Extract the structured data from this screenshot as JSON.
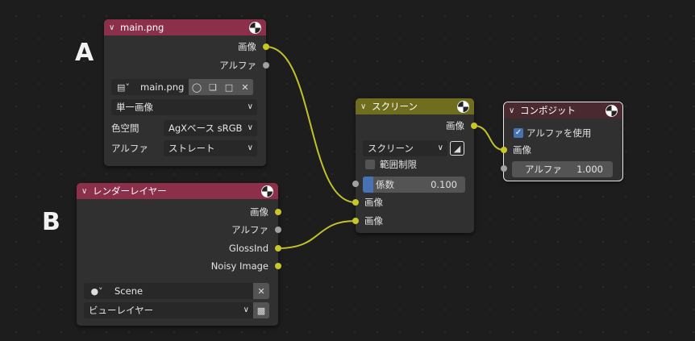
{
  "annotations": {
    "a": "A",
    "b": "B"
  },
  "image_node": {
    "title": "main.png",
    "out_image": "画像",
    "out_alpha": "アルファ",
    "image_name": "main.png",
    "source": "単一画像",
    "color_space_label": "色空間",
    "color_space_value": "AgXベース sRGB",
    "alpha_label": "アルファ",
    "alpha_value": "ストレート",
    "header_color": "#8c2f4a"
  },
  "render_node": {
    "title": "レンダーレイヤー",
    "out_image": "画像",
    "out_alpha": "アルファ",
    "out_glossind": "GlossInd",
    "out_noisy": "Noisy Image",
    "scene": "Scene",
    "view_layer": "ビューレイヤー",
    "header_color": "#8c2f4a"
  },
  "screen_node": {
    "title": "スクリーン",
    "out_image": "画像",
    "blend_mode": "スクリーン",
    "clamp_label": "範囲制限",
    "clamp_checked": false,
    "factor_label": "係数",
    "factor_value": "0.100",
    "factor_fraction": 0.1,
    "in_image1": "画像",
    "in_image2": "画像",
    "header_color": "#6e6e1e"
  },
  "composite_node": {
    "title": "コンポジット",
    "use_alpha_label": "アルファを使用",
    "use_alpha_checked": true,
    "in_image": "画像",
    "alpha_label": "アルファ",
    "alpha_value": "1.000",
    "header_color": "#4a2a30"
  },
  "colors": {
    "socket_color": "#c7c729",
    "wire_color": "#c2c22a",
    "accent": "#4772b3"
  }
}
